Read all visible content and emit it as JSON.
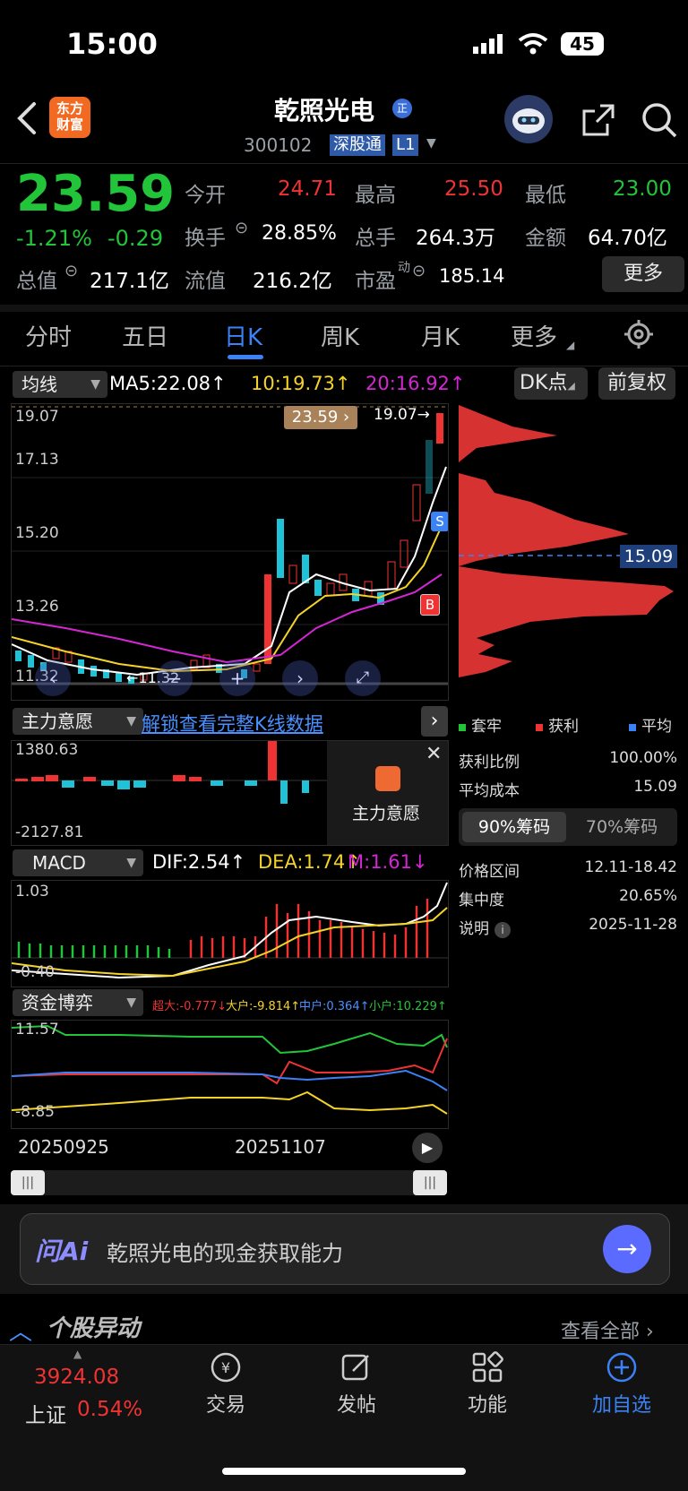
{
  "status_bar": {
    "time": "15:00",
    "battery": "45"
  },
  "header": {
    "app_logo": "东方\n财富",
    "stock_name": "乾照光电",
    "stock_code": "300102",
    "market_badge": "深股通",
    "level_badge": "L1",
    "zheng_badge": "正"
  },
  "quote": {
    "price": "23.59",
    "pct_change": "-1.21%",
    "abs_change": "-0.29",
    "open_label": "今开",
    "open": "24.71",
    "high_label": "最高",
    "high": "25.50",
    "low_label": "最低",
    "low": "23.00",
    "turnover_label": "换手",
    "turnover": "28.85%",
    "volume_label": "总手",
    "volume": "264.3万",
    "amount_label": "金额",
    "amount": "64.70亿",
    "mktcap_label": "总值",
    "mktcap": "217.1亿",
    "float_label": "流值",
    "float_cap": "216.2亿",
    "pe_label": "市盈",
    "pe_sup": "动",
    "pe": "185.14",
    "more_button": "更多"
  },
  "tabs": [
    "分时",
    "五日",
    "日K",
    "周K",
    "月K",
    "更多"
  ],
  "active_tab": 2,
  "ma_bar": {
    "selector": "均线",
    "ma5": "MA5:22.08↑",
    "ma10": "10:19.73↑",
    "ma20": "20:16.92↑",
    "dk_button": "DK点",
    "adjust_button": "前复权"
  },
  "kline": {
    "y_labels": [
      "19.07",
      "17.13",
      "15.20",
      "13.26",
      "11.32"
    ],
    "price_tag": "23.59",
    "top_marker": "19.07→",
    "low_marker": "←11.32",
    "sell_marker": "S",
    "buy_marker": "B"
  },
  "chip": {
    "avg_tag": "15.09",
    "legend_trapped": "套牢",
    "legend_profit": "获利",
    "legend_avg": "平均",
    "profit_ratio_label": "获利比例",
    "profit_ratio": "100.00%",
    "avg_cost_label": "平均成本",
    "avg_cost": "15.09",
    "tab_90": "90%筹码",
    "tab_70": "70%筹码",
    "range_label": "价格区间",
    "range": "12.11-18.42",
    "concentration_label": "集中度",
    "concentration": "20.65%",
    "note_label": "说明",
    "note_date": "2025-11-28"
  },
  "main_force": {
    "selector": "主力意愿",
    "unlock_link": "解锁查看完整K线数据",
    "top": "1380.63",
    "bottom": "-2127.81",
    "overlay_label": "主力意愿"
  },
  "macd": {
    "selector": "MACD",
    "dif": "DIF:2.54↑",
    "dea": "DEA:1.74↑",
    "m": "M:1.61↓",
    "top": "1.03",
    "bottom": "-0.40"
  },
  "fund": {
    "selector": "资金博弈",
    "super": "超大:-0.777↓",
    "large": "大户:-9.814↑",
    "mid": "中户:0.364↑",
    "small": "小户:10.229↑",
    "top": "11.57",
    "bottom": "-8.85"
  },
  "dates": {
    "start": "20250925",
    "mid": "20251107"
  },
  "ai": {
    "brand": "问Ai",
    "prompt": "乾照光电的现金获取能力"
  },
  "news": {
    "title": "个股异动",
    "view_all": "查看全部"
  },
  "bottom_nav": {
    "index_value": "3924.08",
    "index_name": "上证",
    "index_pct": "0.54%",
    "trade": "交易",
    "post": "发帖",
    "functions": "功能",
    "add_watch": "加自选"
  },
  "colors": {
    "up": "#ef3333",
    "down": "#22c43a",
    "accent": "#3b82f6",
    "ma5": "#ffffff",
    "ma10": "#f5d328",
    "ma20": "#d526d4"
  }
}
